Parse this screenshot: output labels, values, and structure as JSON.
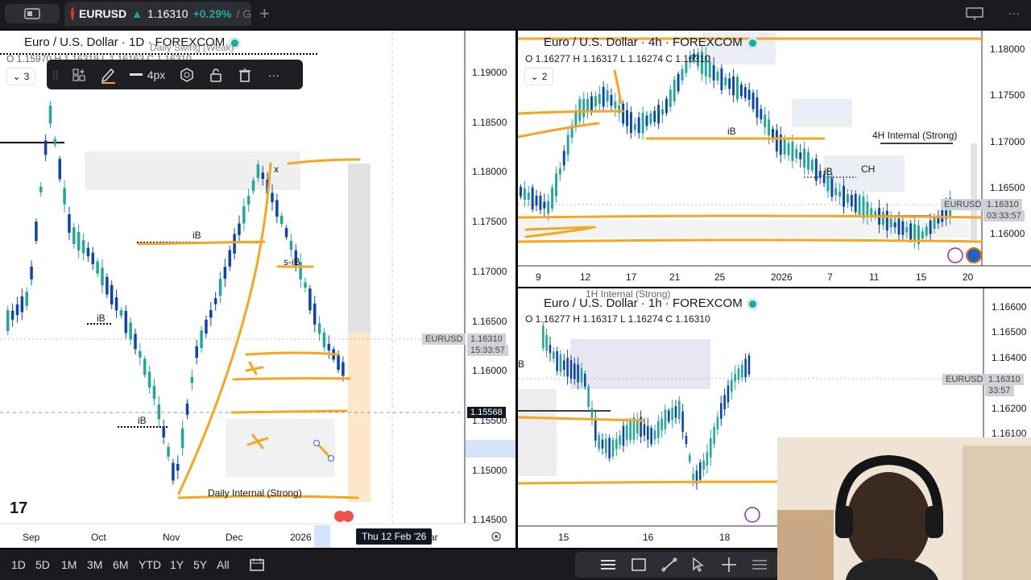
{
  "window_tab": {
    "symbol": "EURUSD",
    "price": "1.16310",
    "change": "+0.29%",
    "arrow": "▲",
    "rest": "/ G"
  },
  "left_chart": {
    "title": "Euro / U.S. Dollar · 1D · FOREXCOM",
    "ohlc": "O 1.15970  H 1.16318  L 1.16163  C 1.16310",
    "collapse_count": "3",
    "toolbar": {
      "width_label": "4px"
    },
    "price_axis": [
      "1.19000",
      "1.18500",
      "1.18000",
      "1.17500",
      "1.17000",
      "1.16500",
      "1.16000",
      "1.15500",
      "1.15000",
      "1.14500"
    ],
    "time_axis": [
      "Sep",
      "Oct",
      "Nov",
      "Dec",
      "2026",
      "ar"
    ],
    "last_price_tag": {
      "symbol": "EURUSD",
      "price": "1.16310",
      "countdown": "15:33:57"
    },
    "crosshair_price": "1.15568",
    "hover_date": "Thu 12 Feb '26",
    "annotations": {
      "swing": "Daily Swing (Weak)",
      "ib_top": "iB",
      "ib_left": "iB",
      "ib_bottom": "iB",
      "x_mark": "x",
      "sib": "s-iB",
      "daily_internal": "Daily Internal (Strong)"
    },
    "logo": "17"
  },
  "h4_chart": {
    "title": "Euro / U.S. Dollar · 4h · FOREXCOM",
    "ohlc": "O 1.16277  H 1.16317  L 1.16274  C 1.16310",
    "collapse_count": "2",
    "price_axis": [
      "1.18000",
      "1.17500",
      "1.17000",
      "1.16500",
      "1.16000"
    ],
    "time_axis": [
      "9",
      "12",
      "17",
      "21",
      "25",
      "2026",
      "7",
      "11",
      "15",
      "20"
    ],
    "last_price_tag": {
      "symbol": "EURUSD",
      "price": "1.16310",
      "countdown": "03:33:57"
    },
    "annotations": {
      "ib1": "iB",
      "ib2": "iB",
      "ch": "CH",
      "internal": "4H Internal (Strong)",
      "top_ib": "iB"
    }
  },
  "h1_chart": {
    "title": "Euro / U.S. Dollar · 1h · FOREXCOM",
    "ohlc": "O 1.16277  H 1.16317  L 1.16274  C 1.16310",
    "price_axis": [
      "1.16600",
      "1.16500",
      "1.16400",
      "1.16200",
      "1.16100"
    ],
    "time_axis": [
      "15",
      "16",
      "18"
    ],
    "last_price_tag": {
      "symbol": "EURUSD",
      "price": "1.16310",
      "countdown": "33:57"
    },
    "annotations": {
      "internal": "1H Internal (Strong)",
      "b": "B"
    }
  },
  "bottom_bar": {
    "timeframes": [
      "1D",
      "5D",
      "1M",
      "3M",
      "6M",
      "YTD",
      "1Y",
      "5Y",
      "All"
    ]
  },
  "colors": {
    "bull": "#26a69a",
    "bear": "#0d47a1",
    "orange": "#f5a623",
    "bg_dark": "#1a1b1e"
  }
}
